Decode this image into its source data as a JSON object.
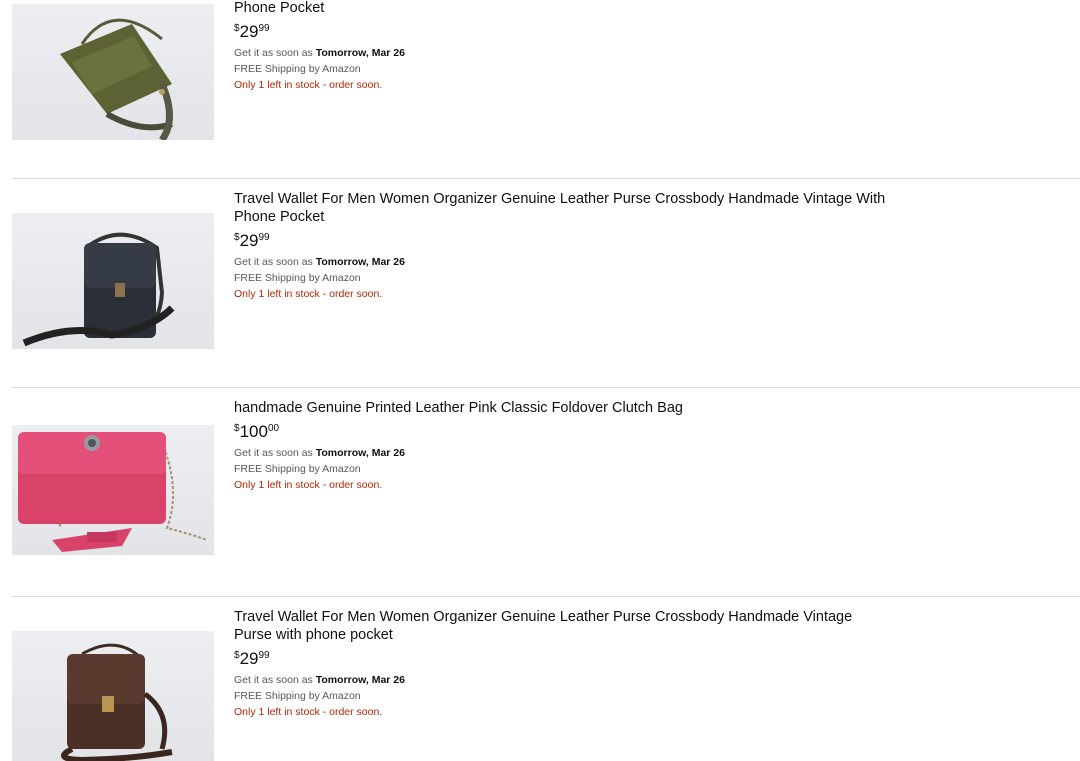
{
  "results": [
    {
      "title": "Phone Pocket",
      "price_symbol": "$",
      "price_whole": "29",
      "price_fraction": "99",
      "delivery_prefix": "Get it as soon as",
      "delivery_date": "Tomorrow, Mar 26",
      "shipping": "FREE Shipping by Amazon",
      "stock": "Only 1 left in stock - order soon.",
      "image_icon": "olive-crossbody-bag-image"
    },
    {
      "title": "Travel Wallet For Men Women Organizer Genuine Leather Purse Crossbody Handmade Vintage With Phone Pocket",
      "price_symbol": "$",
      "price_whole": "29",
      "price_fraction": "99",
      "delivery_prefix": "Get it as soon as",
      "delivery_date": "Tomorrow, Mar 26",
      "shipping": "FREE Shipping by Amazon",
      "stock": "Only 1 left in stock - order soon.",
      "image_icon": "black-crossbody-bag-image"
    },
    {
      "title": "handmade Genuine Printed Leather Pink Classic Foldover Clutch Bag",
      "price_symbol": "$",
      "price_whole": "100",
      "price_fraction": "00",
      "delivery_prefix": "Get it as soon as",
      "delivery_date": "Tomorrow, Mar 26",
      "shipping": "FREE Shipping by Amazon",
      "stock": "Only 1 left in stock - order soon.",
      "image_icon": "pink-clutch-bag-image"
    },
    {
      "title": "Travel Wallet For Men Women Organizer Genuine Leather Purse Crossbody Handmade Vintage Purse with phone pocket",
      "price_symbol": "$",
      "price_whole": "29",
      "price_fraction": "99",
      "delivery_prefix": "Get it as soon as",
      "delivery_date": "Tomorrow, Mar 26",
      "shipping": "FREE Shipping by Amazon",
      "stock": "Only 1 left in stock - order soon.",
      "image_icon": "brown-crossbody-bag-image"
    }
  ],
  "colors": {
    "stock_red": "#b12704",
    "text_primary": "#0f1111",
    "text_secondary": "#565959",
    "divider": "#dddddd"
  }
}
